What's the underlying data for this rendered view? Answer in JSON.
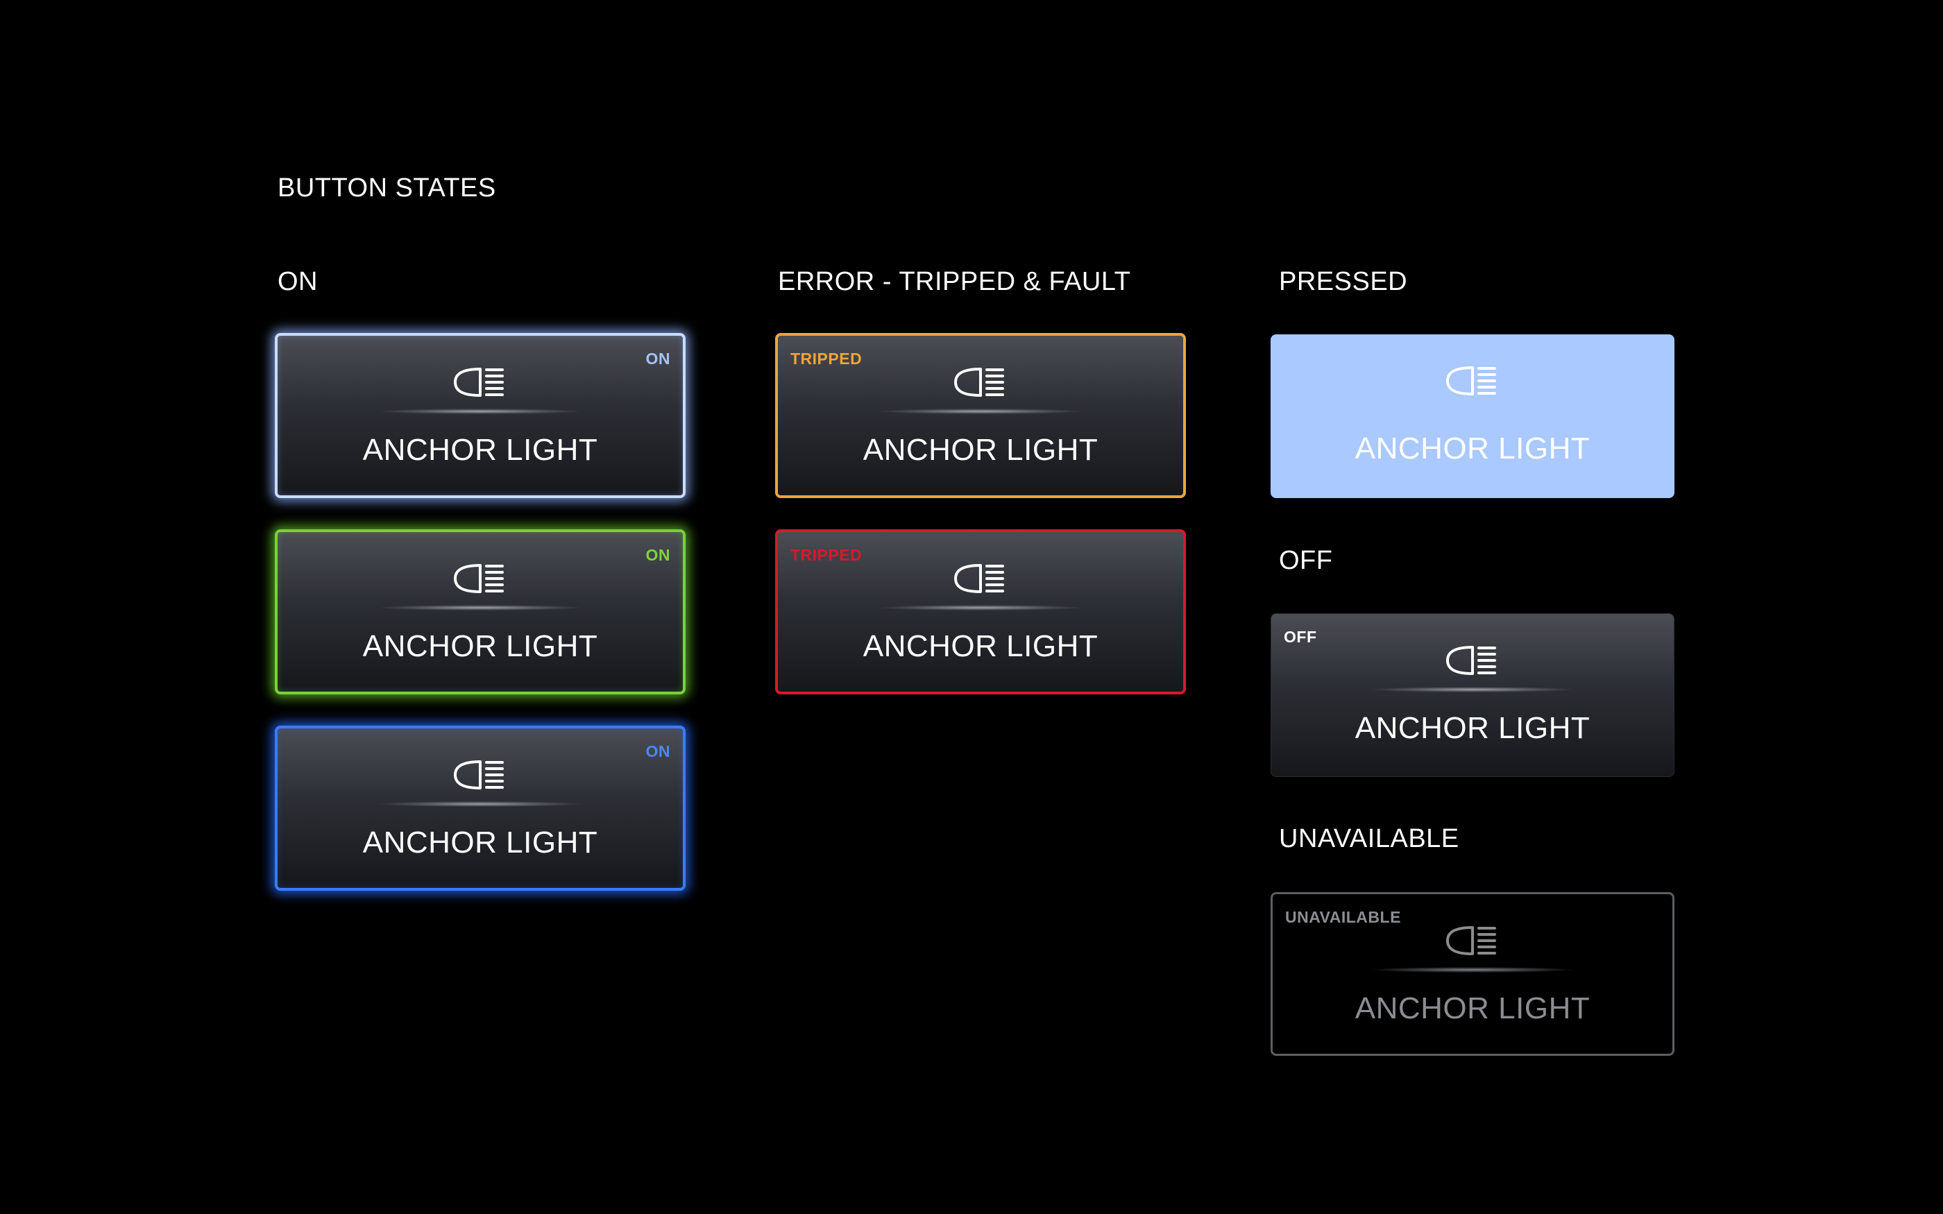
{
  "page": {
    "title": "BUTTON STATES"
  },
  "sections": {
    "on": "ON",
    "error": "ERROR - TRIPPED & FAULT",
    "pressed": "PRESSED",
    "off": "OFF",
    "unavailable": "UNAVAILABLE"
  },
  "buttons": {
    "on_white": {
      "status": "ON",
      "label": "ANCHOR LIGHT",
      "icon": "headlight-icon",
      "accent": "#c9dcff"
    },
    "on_green": {
      "status": "ON",
      "label": "ANCHOR LIGHT",
      "icon": "headlight-icon",
      "accent": "#78d23a"
    },
    "on_blue": {
      "status": "ON",
      "label": "ANCHOR LIGHT",
      "icon": "headlight-icon",
      "accent": "#3b7bff"
    },
    "tripped_orange": {
      "status": "TRIPPED",
      "label": "ANCHOR LIGHT",
      "icon": "headlight-icon",
      "accent": "#f2a435"
    },
    "tripped_red": {
      "status": "TRIPPED",
      "label": "ANCHOR LIGHT",
      "icon": "headlight-icon",
      "accent": "#d9182c"
    },
    "pressed": {
      "label": "ANCHOR LIGHT",
      "icon": "headlight-icon",
      "accent": "#a9c9ff"
    },
    "off": {
      "status": "OFF",
      "label": "ANCHOR LIGHT",
      "icon": "headlight-icon"
    },
    "unavailable": {
      "status": "UNAVAILABLE",
      "label": "ANCHOR LIGHT",
      "icon": "headlight-icon",
      "accent": "#5c5e62"
    }
  }
}
